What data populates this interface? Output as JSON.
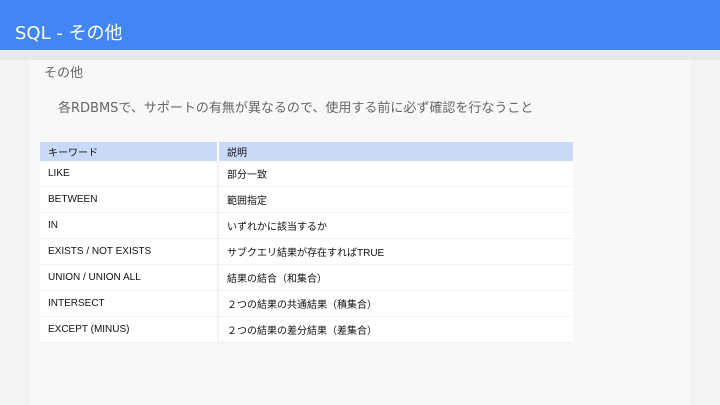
{
  "header": {
    "title": "SQL - その他"
  },
  "section": {
    "title": "その他",
    "lead": "各RDBMSで、サポートの有無が異なるので、使用する前に必ず確認を行なうこと"
  },
  "table": {
    "columns": [
      "キーワード",
      "説明"
    ],
    "rows": [
      [
        "LIKE",
        "部分一致"
      ],
      [
        "BETWEEN",
        "範囲指定"
      ],
      [
        "IN",
        "いずれかに該当するか"
      ],
      [
        "EXISTS / NOT EXISTS",
        "サブクエリ結果が存在すればTRUE"
      ],
      [
        "UNION / UNION ALL",
        "結果の結合（和集合）"
      ],
      [
        "INTERSECT",
        "２つの結果の共通結果（積集合）"
      ],
      [
        "EXCEPT (MINUS)",
        "２つの結果の差分結果（差集合）"
      ]
    ]
  },
  "colors": {
    "header_bg": "#4285f4",
    "table_header_bg": "#c9daf8"
  }
}
